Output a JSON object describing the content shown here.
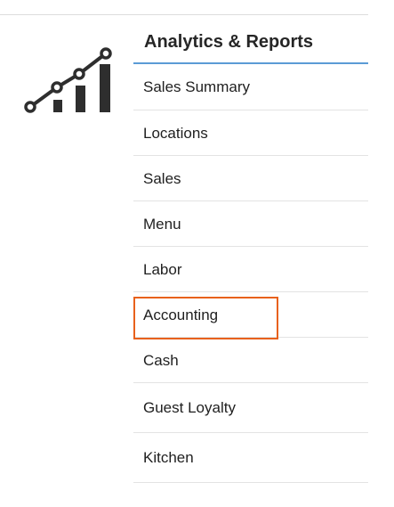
{
  "panel": {
    "title": "Analytics & Reports",
    "icon": "analytics-chart-icon",
    "accent_color": "#5b9bd5"
  },
  "menu": {
    "items": [
      {
        "label": "Sales Summary"
      },
      {
        "label": "Locations"
      },
      {
        "label": "Sales"
      },
      {
        "label": "Menu"
      },
      {
        "label": "Labor"
      },
      {
        "label": "Accounting",
        "highlighted": true
      },
      {
        "label": "Cash"
      },
      {
        "label": "Guest Loyalty"
      },
      {
        "label": "Kitchen"
      }
    ]
  },
  "highlight": {
    "color": "#e8611c",
    "target": "Accounting"
  }
}
